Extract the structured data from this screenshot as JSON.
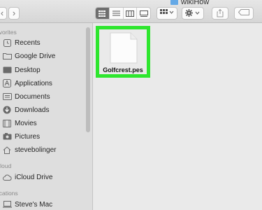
{
  "window": {
    "title": "wikiHow"
  },
  "toolbar": {
    "back_glyph": "‹",
    "forward_glyph": "›",
    "icons": [
      "icon-view-grid",
      "list-view-icon",
      "column-view-icon",
      "gallery-view-icon",
      "group-by-icon",
      "action-gear-icon",
      "share-icon",
      "tag-icon"
    ]
  },
  "sidebar": {
    "sections": [
      {
        "title": "avorites"
      },
      {
        "title": "Cloud"
      },
      {
        "title": "ocations"
      }
    ],
    "favorites": [
      {
        "label": "Recents",
        "icon": "clock-icon"
      },
      {
        "label": "Google Drive",
        "icon": "folder-icon"
      },
      {
        "label": "Desktop",
        "icon": "desktop-icon"
      },
      {
        "label": "Applications",
        "icon": "applications-icon"
      },
      {
        "label": "Documents",
        "icon": "documents-icon"
      },
      {
        "label": "Downloads",
        "icon": "downloads-icon"
      },
      {
        "label": "Movies",
        "icon": "movies-icon"
      },
      {
        "label": "Pictures",
        "icon": "pictures-icon"
      },
      {
        "label": "stevebolinger",
        "icon": "home-icon"
      }
    ],
    "icloud": [
      {
        "label": "iCloud Drive",
        "icon": "cloud-icon"
      }
    ],
    "locations": [
      {
        "label": "Steve's Mac",
        "icon": "computer-icon"
      }
    ]
  },
  "main": {
    "files": [
      {
        "name": "Golfcrest.pes",
        "icon": "document-icon",
        "selected": true
      }
    ]
  },
  "colors": {
    "highlight": "#2ee62e",
    "folder": "#65a9e6"
  }
}
